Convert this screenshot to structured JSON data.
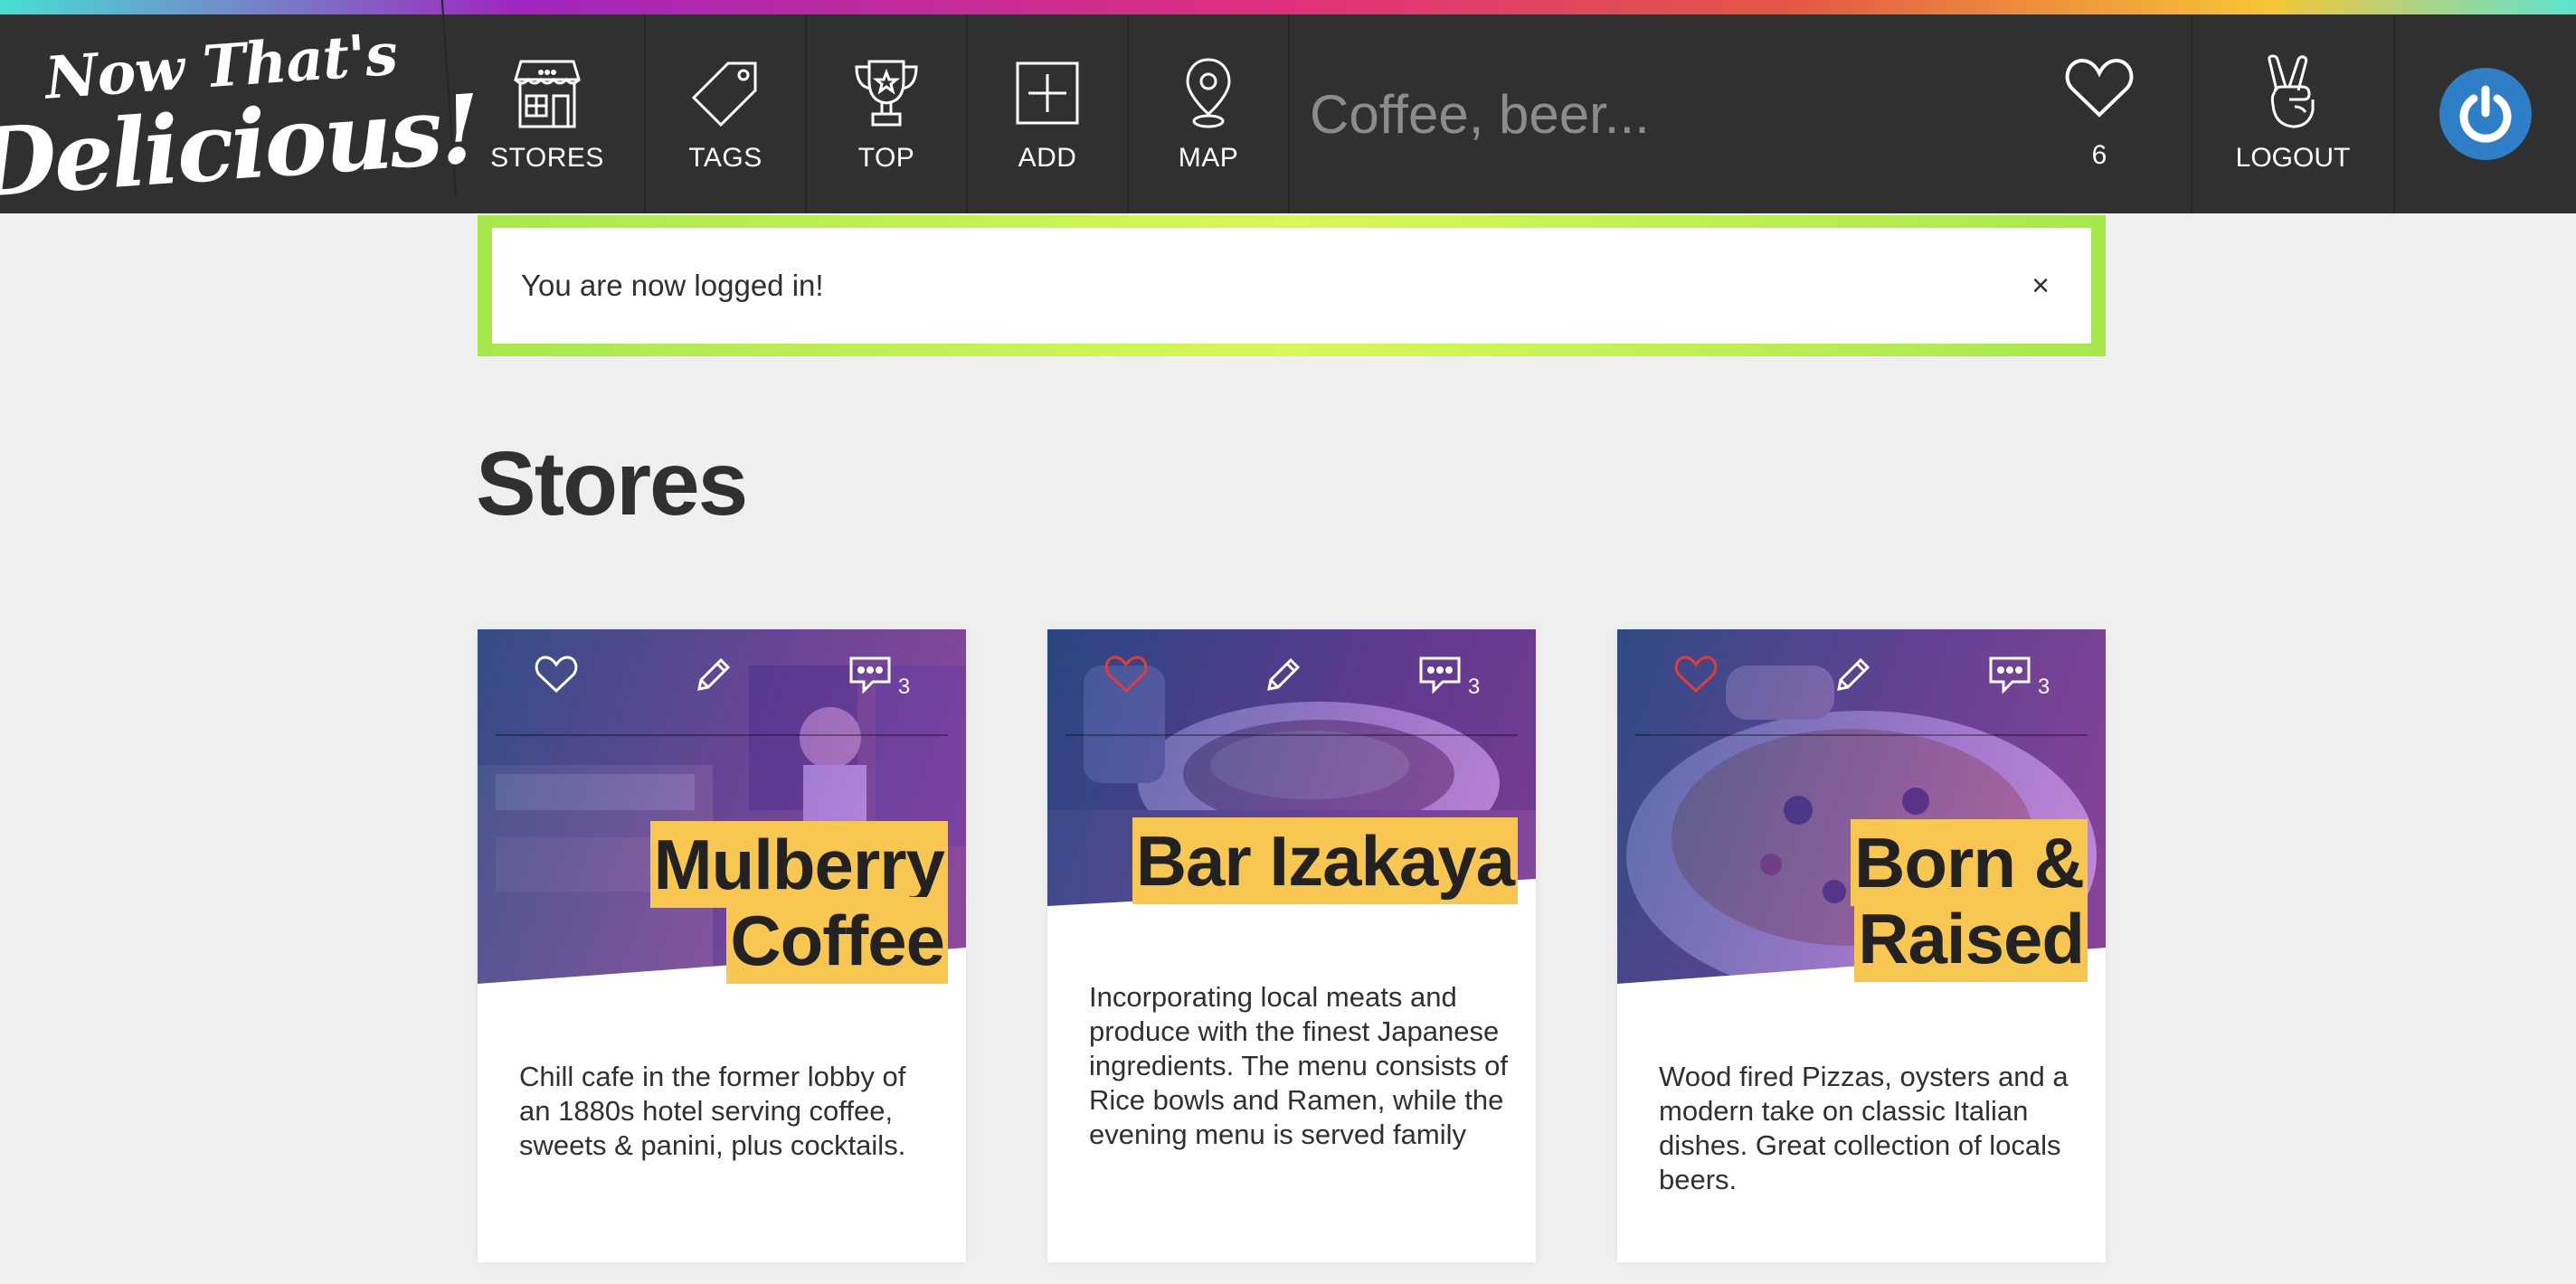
{
  "logo": {
    "line1": "Now That's",
    "line2": "Delicious!"
  },
  "nav": {
    "stores": "STORES",
    "tags": "TAGS",
    "top": "TOP",
    "add": "ADD",
    "map": "MAP",
    "search_placeholder": "Coffee, beer...",
    "hearts_count": "6",
    "logout": "LOGOUT"
  },
  "flash": {
    "message": "You are now logged in!",
    "close": "×"
  },
  "page": {
    "title": "Stores"
  },
  "stores": [
    {
      "name_line1": "Mulberry",
      "name_line2": "Coffee",
      "comments": "3",
      "hearted": false,
      "description": "Chill cafe in the former lobby of an 1880s hotel serving coffee, sweets & panini, plus cocktails."
    },
    {
      "name_line1": "Bar Izakaya",
      "name_line2": "",
      "comments": "3",
      "hearted": true,
      "description": "Incorporating local meats and produce with the finest Japanese ingredients. The menu consists of Rice bowls and Ramen, while the evening menu is served family"
    },
    {
      "name_line1": "Born &",
      "name_line2": "Raised",
      "comments": "3",
      "hearted": true,
      "description": "Wood fired Pizzas, oysters and a modern take on classic Italian dishes. Great collection of locals beers."
    }
  ],
  "colors": {
    "nav_bg": "#303030",
    "flash_border": "#b4ec4c",
    "title_highlight": "#f7c752",
    "heart_active": "#e33b3b",
    "avatar": "#2f7fc8"
  }
}
